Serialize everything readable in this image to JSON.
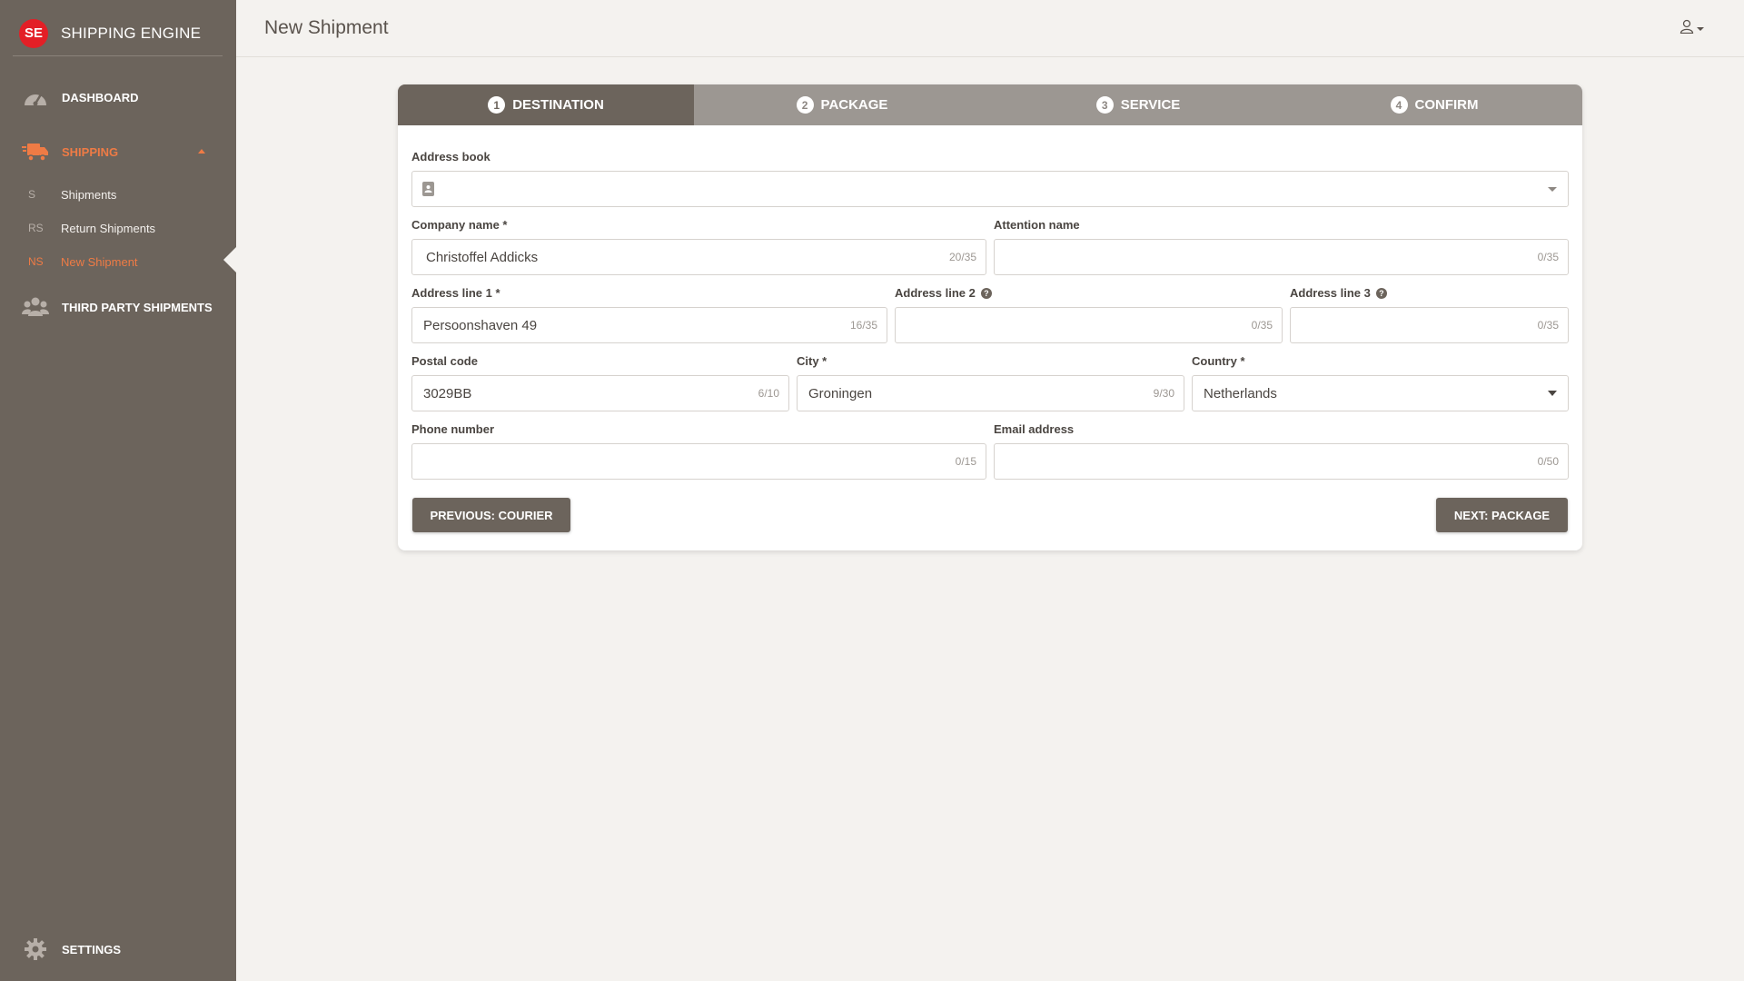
{
  "app": {
    "logo_text": "SE",
    "name": "SHIPPING ENGINE"
  },
  "sidebar": {
    "dashboard": "DASHBOARD",
    "shipping": "SHIPPING",
    "sub_items": [
      {
        "abbr": "S",
        "label": "Shipments"
      },
      {
        "abbr": "RS",
        "label": "Return Shipments"
      },
      {
        "abbr": "NS",
        "label": "New Shipment"
      }
    ],
    "third_party": "THIRD PARTY SHIPMENTS",
    "settings": "SETTINGS"
  },
  "header": {
    "title": "New Shipment"
  },
  "steps": [
    {
      "num": "1",
      "label": "DESTINATION"
    },
    {
      "num": "2",
      "label": "PACKAGE"
    },
    {
      "num": "3",
      "label": "SERVICE"
    },
    {
      "num": "4",
      "label": "CONFIRM"
    }
  ],
  "form": {
    "address_book": {
      "label": "Address book",
      "value": ""
    },
    "company_name": {
      "label": "Company name *",
      "value": "Christoffel Addicks",
      "count": "20/35"
    },
    "attention_name": {
      "label": "Attention name",
      "value": "",
      "count": "0/35"
    },
    "address_line_1": {
      "label": "Address line 1 *",
      "value": "Persoonshaven 49",
      "count": "16/35"
    },
    "address_line_2": {
      "label": "Address line 2",
      "value": "",
      "count": "0/35"
    },
    "address_line_3": {
      "label": "Address line 3",
      "value": "",
      "count": "0/35"
    },
    "postal_code": {
      "label": "Postal code",
      "value": "3029BB",
      "count": "6/10"
    },
    "city": {
      "label": "City *",
      "value": "Groningen",
      "count": "9/30"
    },
    "country": {
      "label": "Country *",
      "value": "Netherlands"
    },
    "phone": {
      "label": "Phone number",
      "value": "",
      "count": "0/15"
    },
    "email": {
      "label": "Email address",
      "value": "",
      "count": "0/50"
    }
  },
  "buttons": {
    "previous": "PREVIOUS: COURIER",
    "next": "NEXT: PACKAGE"
  },
  "colors": {
    "sidebar": "#6c645c",
    "accent": "#ef7b45",
    "logo": "#e31f26",
    "background": "#f4f2ef"
  },
  "icons": [
    "speedometer-icon",
    "truck-icon",
    "users-icon",
    "gear-icon",
    "user-icon",
    "contact-book-icon",
    "help-icon"
  ]
}
